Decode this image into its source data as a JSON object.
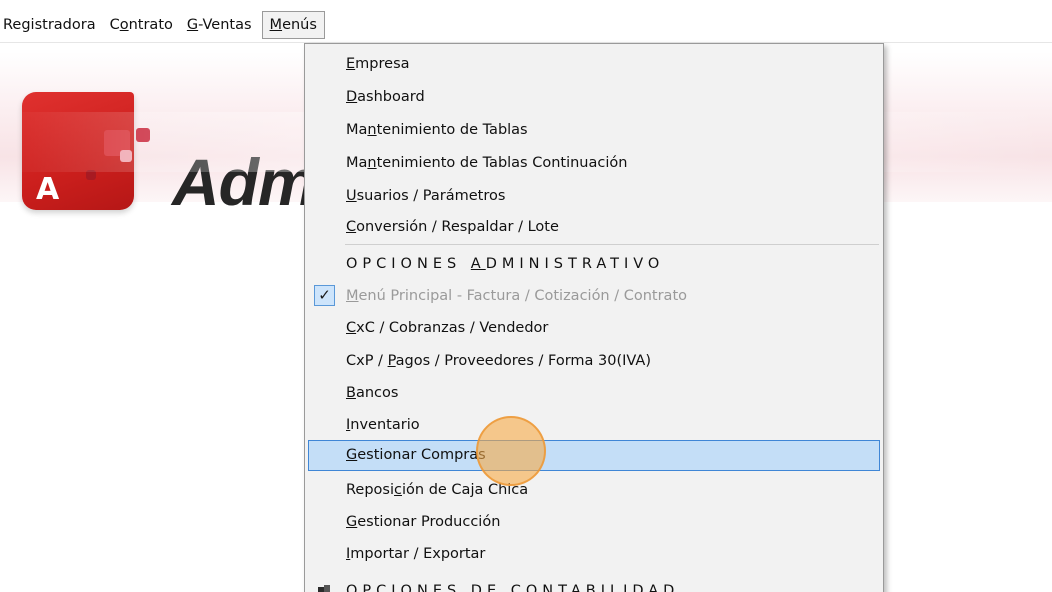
{
  "menubar": {
    "items": [
      {
        "label": "Registradora"
      },
      {
        "label": "Contrato",
        "pre": "C",
        "u": "o",
        "post": "ntrato"
      },
      {
        "label": "G-Ventas",
        "pre": "",
        "u": "G",
        "post": "-Ventas"
      },
      {
        "label": "Menús",
        "pre": "",
        "u": "M",
        "post": "enús"
      }
    ]
  },
  "banner": {
    "logo_letter": "A",
    "brand_text": "Adm"
  },
  "menu": {
    "items": [
      {
        "pre": "",
        "u": "E",
        "post": "mpresa"
      },
      {
        "pre": "",
        "u": "D",
        "post": "ashboard"
      },
      {
        "pre": "Ma",
        "u": "n",
        "post": "tenimiento de Tablas"
      },
      {
        "pre": "Ma",
        "u": "n",
        "post": "tenimiento de Tablas Continuación"
      },
      {
        "pre": "",
        "u": "U",
        "post": "suarios / Parámetros"
      },
      {
        "pre": "",
        "u": "C",
        "post": "onversión / Respaldar / Lote"
      },
      {
        "pre": "OPCIONES ",
        "u": "A",
        "post": "DMINISTRATIVO"
      },
      {
        "pre": "",
        "u": "M",
        "post": "enú Principal - Factura / Cotización / Contrato",
        "checked": "✓"
      },
      {
        "pre": "",
        "u": "C",
        "post": "xC / Cobranzas / Vendedor"
      },
      {
        "pre": "CxP / ",
        "u": "P",
        "post": "agos / Proveedores / Forma 30(IVA)"
      },
      {
        "pre": "",
        "u": "B",
        "post": "ancos"
      },
      {
        "pre": "",
        "u": "I",
        "post": "nventario"
      },
      {
        "pre": "",
        "u": "G",
        "post": "estionar Compras"
      },
      {
        "pre": "Reposi",
        "u": "c",
        "post": "ión de Caja Chica"
      },
      {
        "pre": "",
        "u": "G",
        "post": "estionar Producción"
      },
      {
        "pre": "",
        "u": "I",
        "post": "mportar / Exportar"
      },
      {
        "pre": "OPCIONES DE CONTABILIDAD",
        "u": "",
        "post": ""
      }
    ]
  },
  "colors": {
    "highlight_bg": "#c4def7",
    "highlight_border": "#3f86d6",
    "logo_red": "#d42624",
    "cursor": "#f4a84a"
  }
}
